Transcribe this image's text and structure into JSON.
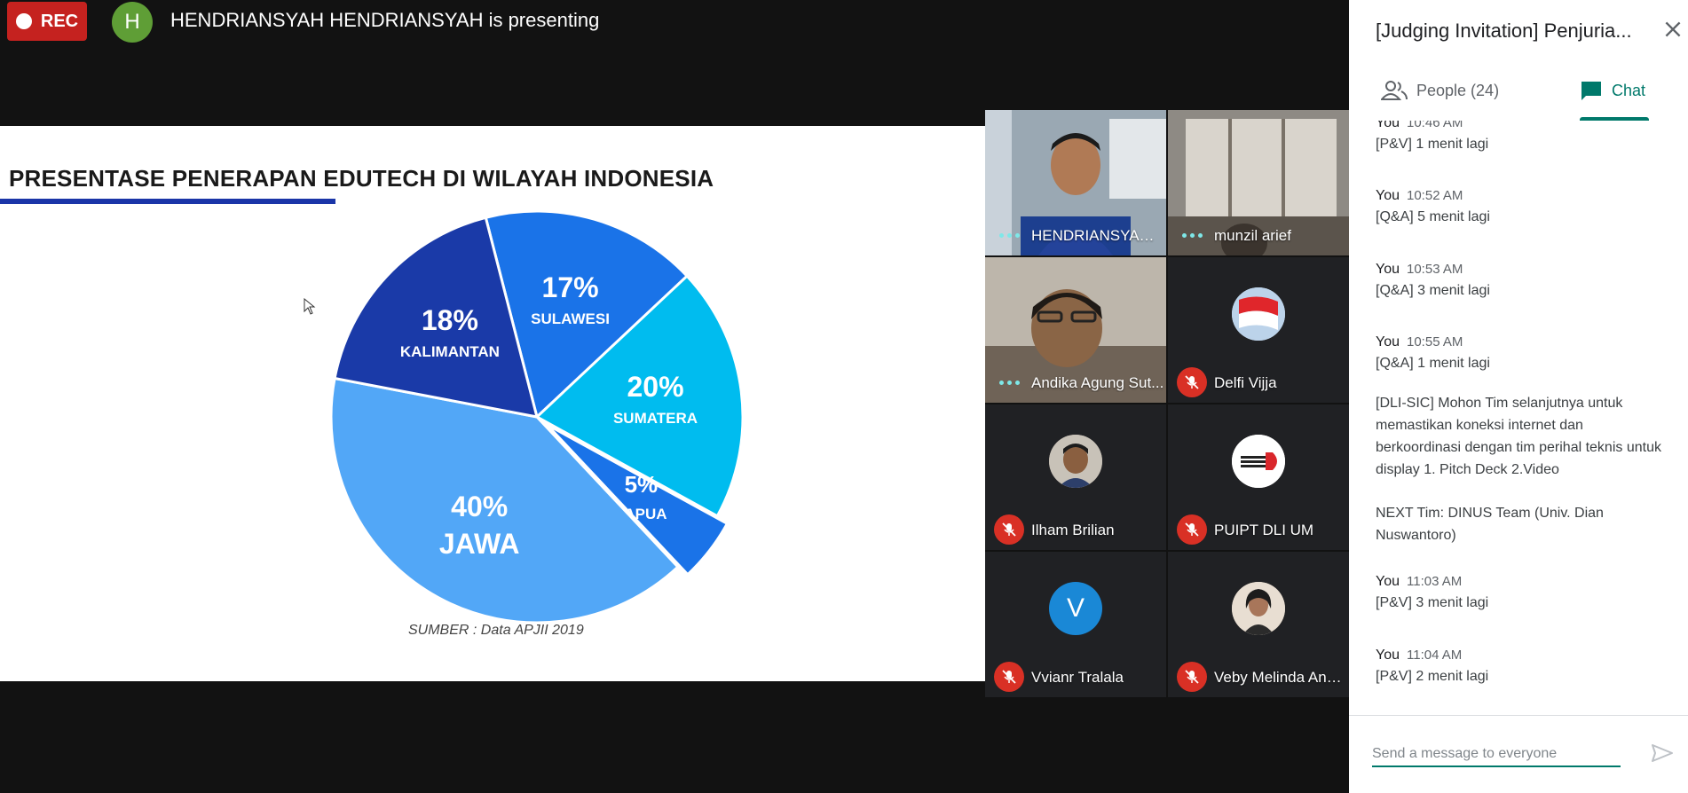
{
  "topbar": {
    "rec_label": "REC",
    "presenter_initial": "H",
    "presenter_text": "HENDRIANSYAH HENDRIANSYAH is presenting"
  },
  "slide": {
    "title": "PRESENTASE PENERAPAN EDUTECH DI WILAYAH INDONESIA",
    "source": "SUMBER : Data APJII 2019"
  },
  "chart_data": {
    "type": "pie",
    "title": "PRESENTASE PENERAPAN EDUTECH DI WILAYAH INDONESIA",
    "slices": [
      {
        "label": "SULAWESI",
        "value": 17,
        "display": "17%",
        "color": "#1a73e8"
      },
      {
        "label": "SUMATERA",
        "value": 20,
        "display": "20%",
        "color": "#00bcef"
      },
      {
        "label": "PAPUA",
        "value": 5,
        "display": "5%",
        "color": "#1a73e8"
      },
      {
        "label": "JAWA",
        "value": 40,
        "display": "40%",
        "color": "#52a7f7"
      },
      {
        "label": "KALIMANTAN",
        "value": 18,
        "display": "18%",
        "color": "#1a3aa8"
      }
    ],
    "source": "SUMBER : Data APJII 2019"
  },
  "participants": [
    {
      "name": "HENDRIANSYAH ...",
      "state": "speaking",
      "kind": "video"
    },
    {
      "name": "munzil arief",
      "state": "speaking",
      "kind": "video"
    },
    {
      "name": "Andika Agung Sut...",
      "state": "speaking",
      "kind": "video"
    },
    {
      "name": "Delfi Vijja",
      "state": "muted",
      "kind": "avatar-flag"
    },
    {
      "name": "Ilham Brilian",
      "state": "muted",
      "kind": "avatar-photo"
    },
    {
      "name": "PUIPT DLI UM",
      "state": "muted",
      "kind": "avatar-logo"
    },
    {
      "name": "Vvianr Tralala",
      "state": "muted",
      "kind": "avatar-letter",
      "initial": "V"
    },
    {
      "name": "Veby Melinda Ann...",
      "state": "muted",
      "kind": "avatar-photo"
    }
  ],
  "panel": {
    "title": "[Judging Invitation] Penjuria...",
    "tabs": {
      "people": "People (24)",
      "chat": "Chat"
    },
    "messages": [
      {
        "who": "You",
        "time": "10:46 AM",
        "text": "[P&V]  1 menit lagi"
      },
      {
        "who": "You",
        "time": "10:52 AM",
        "text": "[Q&A] 5 menit lagi"
      },
      {
        "who": "You",
        "time": "10:53 AM",
        "text": "[Q&A] 3 menit lagi"
      },
      {
        "who": "You",
        "time": "10:55 AM",
        "text": "[Q&A] 1 menit lagi"
      },
      {
        "who": "",
        "time": "",
        "text": "[DLI-SIC] Mohon Tim selanjutnya untuk memastikan koneksi internet dan berkoordinasi dengan tim perihal teknis untuk display 1. Pitch Deck 2.Video"
      },
      {
        "who": "",
        "time": "",
        "text": "NEXT Tim: DINUS Team (Univ. Dian Nuswantoro)"
      },
      {
        "who": "You",
        "time": "11:03 AM",
        "text": "[P&V] 3 menit lagi"
      },
      {
        "who": "You",
        "time": "11:04 AM",
        "text": "[P&V] 2 menit lagi"
      }
    ],
    "input_placeholder": "Send a message to everyone"
  }
}
